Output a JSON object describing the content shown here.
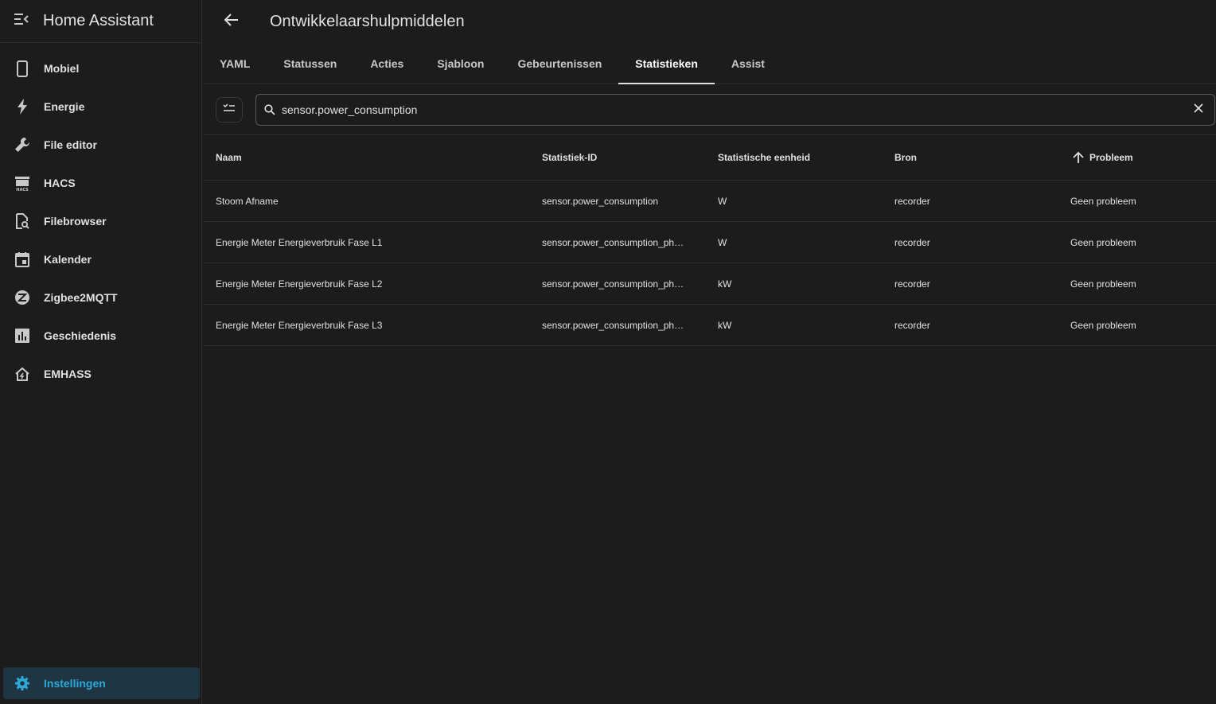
{
  "app": {
    "title": "Home Assistant"
  },
  "sidebar": {
    "items": [
      {
        "label": "Mobiel",
        "icon": "cellphone-icon"
      },
      {
        "label": "Energie",
        "icon": "lightning-icon"
      },
      {
        "label": "File editor",
        "icon": "wrench-icon"
      },
      {
        "label": "HACS",
        "icon": "hacs-icon"
      },
      {
        "label": "Filebrowser",
        "icon": "file-search-icon"
      },
      {
        "label": "Kalender",
        "icon": "calendar-icon"
      },
      {
        "label": "Zigbee2MQTT",
        "icon": "zigbee-icon"
      },
      {
        "label": "Geschiedenis",
        "icon": "chart-bar-icon"
      },
      {
        "label": "EMHASS",
        "icon": "home-lightning-icon"
      }
    ],
    "settings": {
      "label": "Instellingen",
      "icon": "cog-icon"
    }
  },
  "header": {
    "title": "Ontwikkelaarshulpmiddelen"
  },
  "tabs": [
    {
      "label": "YAML"
    },
    {
      "label": "Statussen"
    },
    {
      "label": "Acties"
    },
    {
      "label": "Sjabloon"
    },
    {
      "label": "Gebeurtenissen"
    },
    {
      "label": "Statistieken",
      "active": true
    },
    {
      "label": "Assist"
    }
  ],
  "search": {
    "value": "sensor.power_consumption"
  },
  "table": {
    "columns": [
      "Naam",
      "Statistiek-ID",
      "Statistische eenheid",
      "Bron",
      "Probleem"
    ],
    "rows": [
      [
        "Stoom Afname",
        "sensor.power_consumption",
        "W",
        "recorder",
        "Geen probleem"
      ],
      [
        "Energie Meter Energieverbruik Fase L1",
        "sensor.power_consumption_ph…",
        "W",
        "recorder",
        "Geen probleem"
      ],
      [
        "Energie Meter Energieverbruik Fase L2",
        "sensor.power_consumption_ph…",
        "kW",
        "recorder",
        "Geen probleem"
      ],
      [
        "Energie Meter Energieverbruik Fase L3",
        "sensor.power_consumption_ph…",
        "kW",
        "recorder",
        "Geen probleem"
      ]
    ]
  },
  "colors": {
    "accent": "#2ea8d8",
    "background": "#1c1c1c",
    "active_bg": "#1e3644"
  }
}
